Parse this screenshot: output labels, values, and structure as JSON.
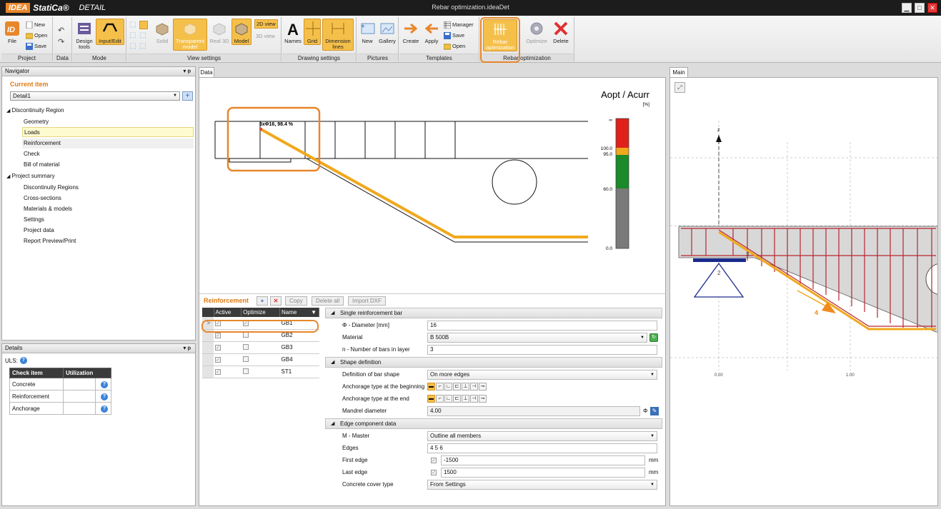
{
  "app": {
    "brand_idea": "IDEA",
    "brand_statica": "StatiCa®",
    "brand_detail": "DETAIL",
    "window_title": "Rebar optimization.ideaDet"
  },
  "ribbon": {
    "file": "File",
    "new": "New",
    "open": "Open",
    "save": "Save",
    "design_tools": "Design tools",
    "input_edit": "Input/Edit",
    "solid": "Solid",
    "transparent_model": "Transparent model",
    "real_3d": "Real 3D",
    "model": "Model",
    "view_2d": "2D view",
    "view_3d": "3D view",
    "names": "Names",
    "grid": "Grid",
    "dimension_lines": "Dimension lines",
    "pictures_new": "New",
    "gallery": "Gallery",
    "create": "Create",
    "apply": "Apply",
    "manager": "Manager",
    "tpl_save": "Save",
    "tpl_open": "Open",
    "rebar_optimization": "Rebar optimization",
    "optimize": "Optimize",
    "delete": "Delete",
    "groups": {
      "project": "Project",
      "data": "Data",
      "mode": "Mode",
      "view_settings": "View settings",
      "drawing_settings": "Drawing settings",
      "pictures": "Pictures",
      "templates": "Templates",
      "rebar_optimization": "Rebar optimization"
    }
  },
  "navigator": {
    "title": "Navigator",
    "pin": "▾ ᵽ",
    "current_item_label": "Current item",
    "current_item_value": "Detail1",
    "tree": [
      "Discontinuity Region",
      "Geometry",
      "Loads",
      "Reinforcement",
      "Check",
      "Bill of material",
      "Project summary",
      "Discontinuity Regions",
      "Cross-sections",
      "Materials & models",
      "Settings",
      "Project data",
      "Report Preview/Print"
    ]
  },
  "details": {
    "title": "Details",
    "uls": "ULS:",
    "headers": [
      "Check item",
      "Utilization"
    ],
    "rows": [
      "Concrete",
      "Reinforcement",
      "Anchorage"
    ]
  },
  "data_tab": {
    "tab_label": "Data",
    "legend_title": "Aopt / Acurr",
    "legend_unit": "[%]",
    "legend_ticks": [
      "∞",
      "100.0",
      "95.0",
      "60.0",
      "0.0"
    ],
    "bar_label": "3xΦ16, 98.4 %"
  },
  "reinforcement": {
    "title": "Reinforcement",
    "copy": "Copy",
    "delete_all": "Delete all",
    "import_dxf": "Import DXF",
    "columns": [
      "Active",
      "Optimize",
      "Name"
    ],
    "rows": [
      {
        "name": "GB1",
        "active": true,
        "optimize": true
      },
      {
        "name": "GB2",
        "active": true,
        "optimize": false
      },
      {
        "name": "GB3",
        "active": true,
        "optimize": false
      },
      {
        "name": "GB4",
        "active": true,
        "optimize": false
      },
      {
        "name": "ST1",
        "active": true,
        "optimize": false
      }
    ]
  },
  "properties": {
    "sec_single": "Single reinforcement bar",
    "diameter_label": "Φ - Diameter [mm]",
    "diameter_value": "16",
    "material_label": "Material",
    "material_value": "B 500B",
    "nbars_label": "n - Number of bars in layer",
    "nbars_value": "3",
    "sec_shape": "Shape definition",
    "def_shape_label": "Definition of bar shape",
    "def_shape_value": "On more edges",
    "anch_begin_label": "Anchorage type at the beginning",
    "anch_end_label": "Anchorage type at the end",
    "mandrel_label": "Mandrel diameter",
    "mandrel_value": "4.00",
    "mandrel_unit": "Φ",
    "sec_edge": "Edge component data",
    "master_label": "M - Master",
    "master_value": "Outline all members",
    "edges_label": "Edges",
    "edges_value": "4 5 6",
    "first_edge_label": "First edge",
    "first_edge_value": "-1500",
    "last_edge_label": "Last edge",
    "last_edge_value": "1500",
    "mm": "mm",
    "cover_label": "Concrete cover type",
    "cover_value": "From Settings"
  },
  "main_view": {
    "tab_label": "Main",
    "axis_z": "z",
    "node_label": "2",
    "edge_label": "3",
    "load_label": "4",
    "x_tick_0": "0.00",
    "x_tick_1": "1.00"
  },
  "colors": {
    "accent": "#e8862a",
    "rebar": "#f0a81c",
    "rebar_red": "#b8262e",
    "legend_red": "#e0201a",
    "legend_green": "#1a8a2a",
    "legend_gray": "#7a7a7a"
  }
}
